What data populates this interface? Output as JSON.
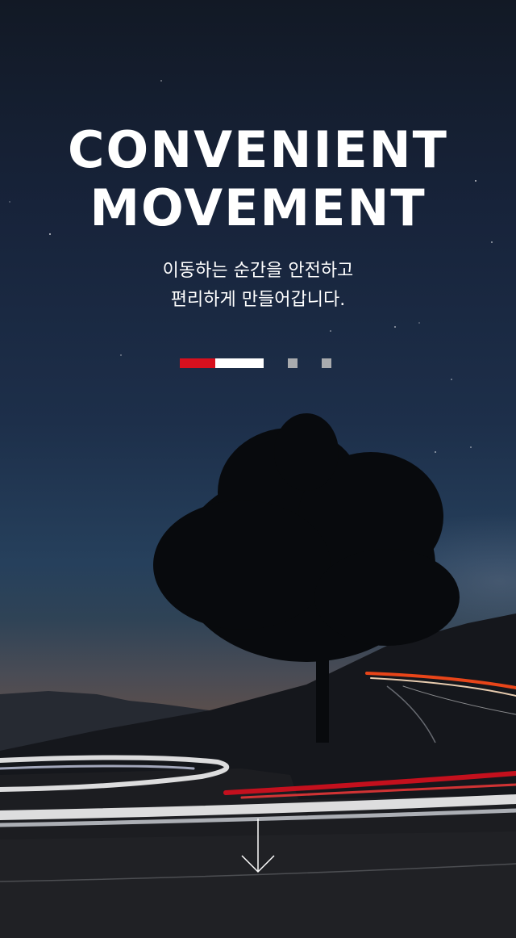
{
  "hero": {
    "headline_line1": "CONVENIENT",
    "headline_line2": "MOVEMENT",
    "subtitle_line1": "이동하는 순간을 안전하고",
    "subtitle_line2": "편리하게 만들어갑니다.",
    "slide_progress": 0.42
  },
  "pager": {
    "dots": [
      "slide-2",
      "slide-3"
    ]
  },
  "icons": {
    "scroll": "arrow-down-icon"
  },
  "colors": {
    "accent": "#d7101e",
    "text": "#ffffff",
    "dot_inactive": "#a9abae"
  }
}
